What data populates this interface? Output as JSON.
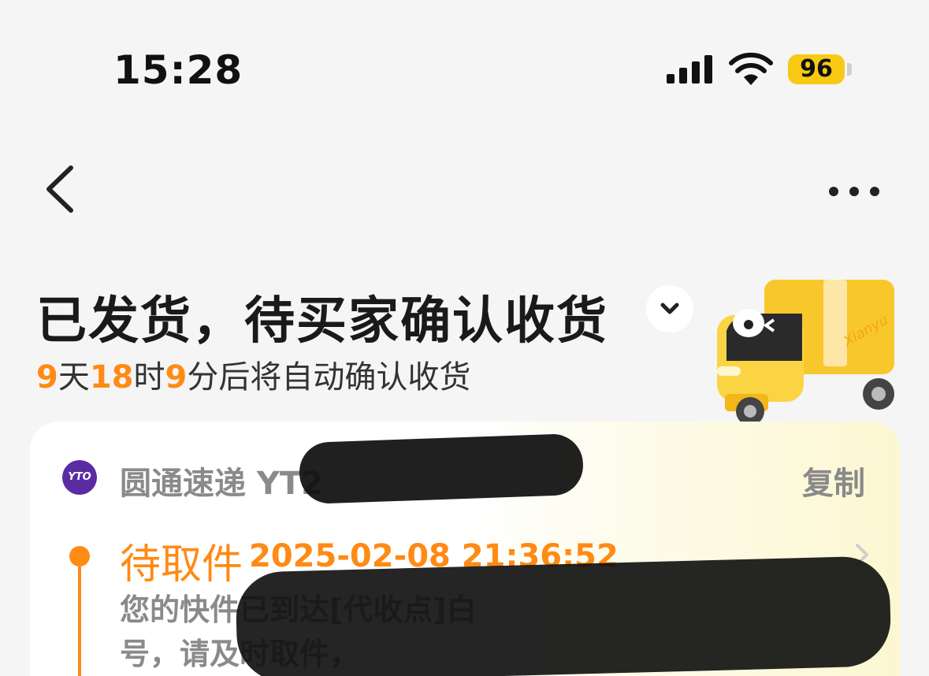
{
  "status_bar": {
    "time": "15:28",
    "battery": "96",
    "icons": [
      "signal-icon",
      "wifi-icon",
      "battery-icon"
    ]
  },
  "nav": {
    "back_icon": "chevron-left-icon",
    "more_icon": "more-dots-icon"
  },
  "order_status": {
    "title": "已发货，待买家确认收货",
    "expand_icon": "chevron-down-icon",
    "countdown": {
      "days": "9",
      "days_unit": "天",
      "hours": "18",
      "hours_unit": "时",
      "minutes": "9",
      "minutes_unit": "分后将自动确认收货"
    },
    "truck_brand": "Xianyu"
  },
  "logistics": {
    "carrier_logo_text": "YTO",
    "carrier_line": "圆通速递 YT2",
    "copy_label": "复制",
    "latest_event": {
      "status": "待取件",
      "time": "2025-02-08 21:36:52",
      "detail_line1": "您的快件已到达[代收点]白",
      "detail_line2": "号，请及时取件，"
    }
  },
  "colors": {
    "accent": "#ff8a14",
    "battery": "#f7c913",
    "carrier": "#5a2ba2",
    "background": "#f5f5f5"
  }
}
